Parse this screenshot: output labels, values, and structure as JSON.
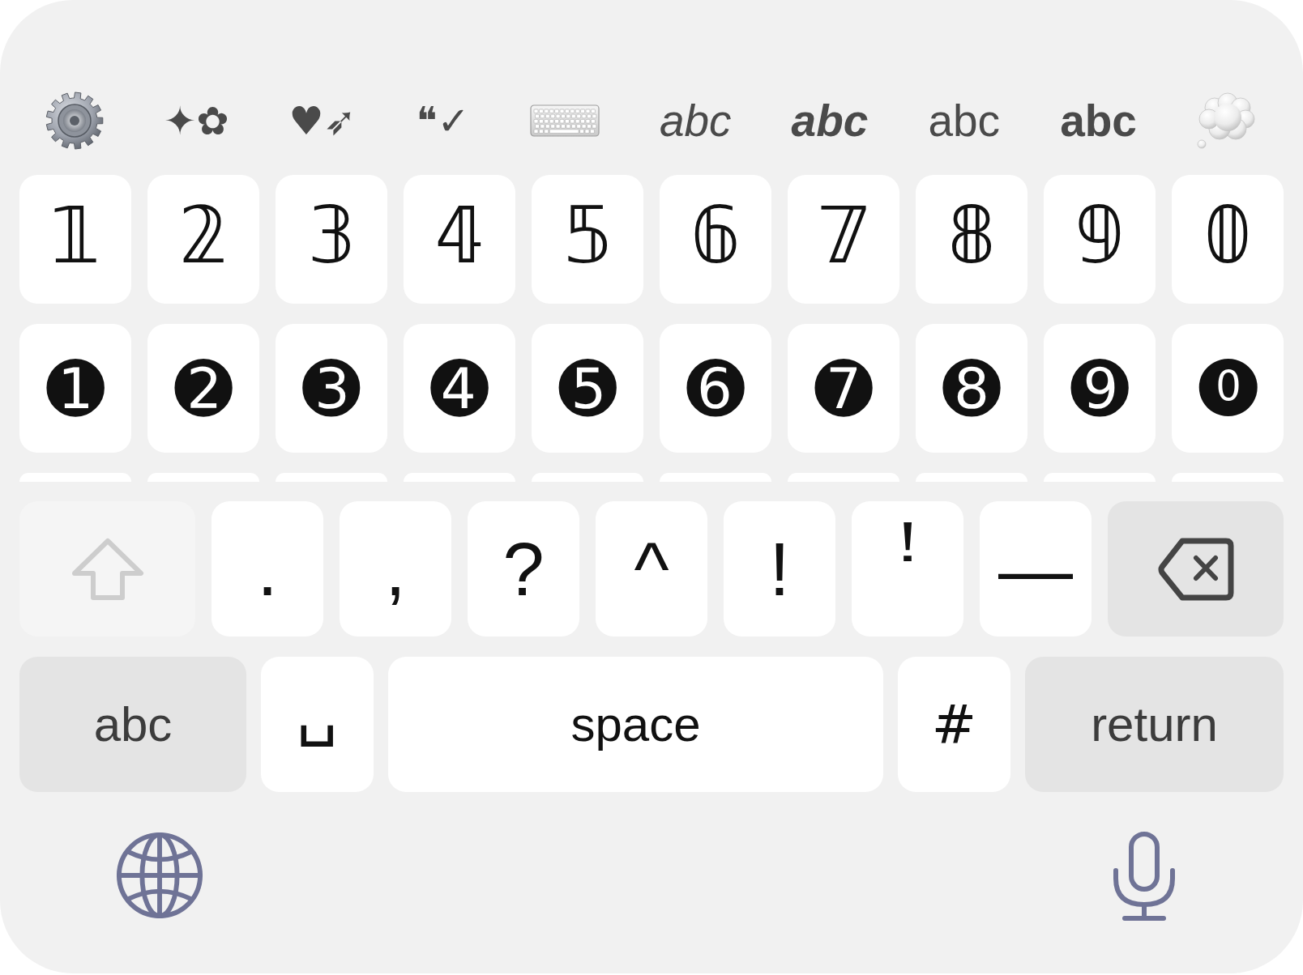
{
  "toolbar": [
    {
      "kind": "settings"
    },
    {
      "kind": "symbols",
      "label": "✦✿"
    },
    {
      "kind": "symbols",
      "label": "♥➶"
    },
    {
      "kind": "symbols",
      "label": "❝✓"
    },
    {
      "kind": "keyboard"
    },
    {
      "kind": "italic",
      "label": "abc"
    },
    {
      "kind": "bolditalic",
      "label": "abc"
    },
    {
      "kind": "plain",
      "label": "abc"
    },
    {
      "kind": "bold",
      "label": "abc"
    },
    {
      "kind": "thought"
    }
  ],
  "number_rows": [
    {
      "keys": [
        "𝟙",
        "𝟚",
        "𝟛",
        "𝟜",
        "𝟝",
        "𝟞",
        "𝟟",
        "𝟠",
        "𝟡",
        "𝟘"
      ]
    },
    {
      "keys": [
        "➊",
        "➋",
        "➌",
        "➍",
        "➎",
        "➏",
        "➐",
        "➑",
        "➒",
        "⓿"
      ]
    }
  ],
  "symbol_row": {
    "shift": {
      "disabled": true
    },
    "keys": [
      ".",
      ",",
      "?",
      "^",
      "!",
      "ꜝ",
      "—"
    ]
  },
  "bottom_row": [
    {
      "kind": "mode",
      "label": "abc"
    },
    {
      "kind": "blank",
      "label": "␣"
    },
    {
      "kind": "space",
      "label": "space"
    },
    {
      "kind": "char",
      "label": "#"
    },
    {
      "kind": "return",
      "label": "return"
    }
  ],
  "footer": [
    {
      "kind": "globe"
    },
    {
      "kind": "dictation"
    }
  ]
}
